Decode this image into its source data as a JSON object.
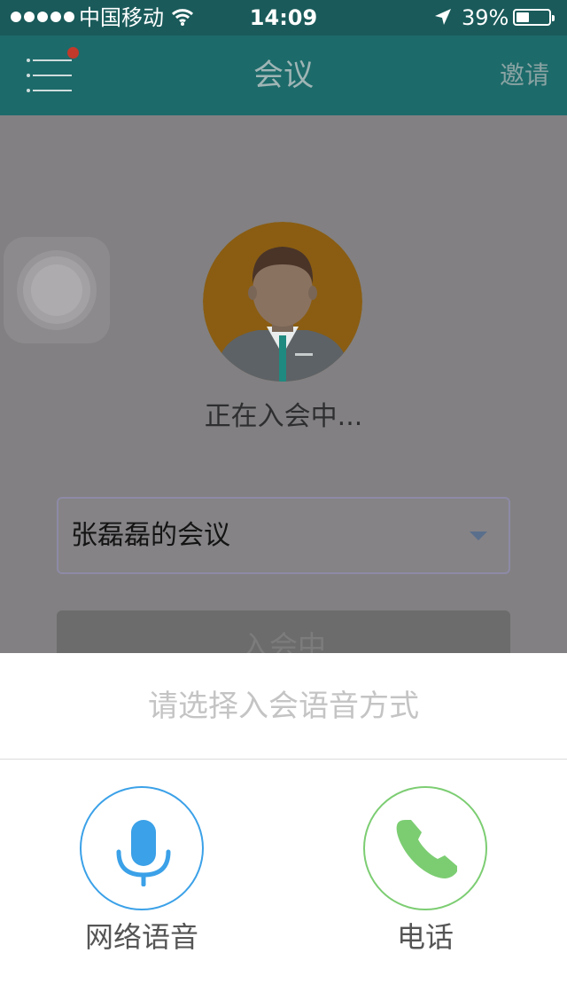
{
  "status_bar": {
    "carrier": "中国移动",
    "time": "14:09",
    "battery_percent": "39%",
    "battery_level": 0.39
  },
  "nav": {
    "title": "会议",
    "invite_label": "邀请"
  },
  "main": {
    "joining_status": "正在入会中...",
    "meeting_select_value": "张磊磊的会议",
    "join_button_label": "入会中"
  },
  "sheet": {
    "title": "请选择入会语音方式",
    "options": [
      {
        "label": "网络语音",
        "icon": "microphone-icon"
      },
      {
        "label": "电话",
        "icon": "phone-icon"
      }
    ]
  },
  "colors": {
    "header": "#1d6a6a",
    "overlay": "#828082",
    "voice_accent": "#3ba1e8",
    "phone_accent": "#7ccd72",
    "avatar_bg": "#b9740f"
  }
}
